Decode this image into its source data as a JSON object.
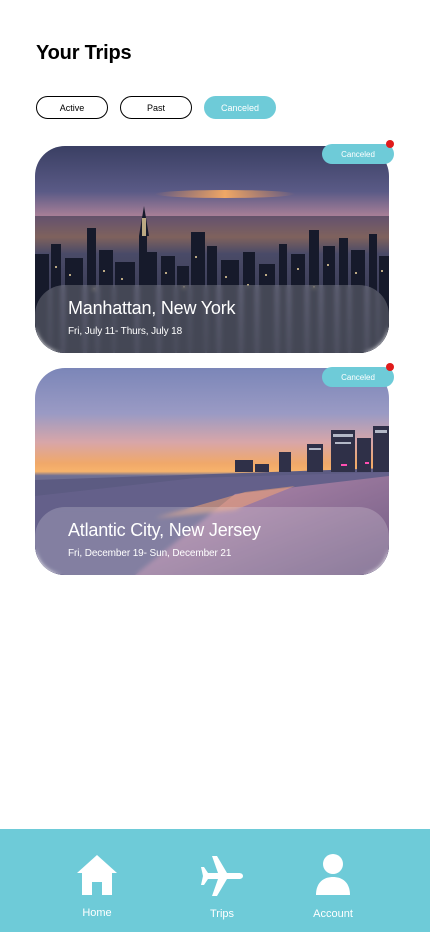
{
  "header": {
    "title": "Your Trips"
  },
  "filters": [
    {
      "label": "Active",
      "selected": false
    },
    {
      "label": "Past",
      "selected": false
    },
    {
      "label": "Canceled",
      "selected": true
    }
  ],
  "trips": [
    {
      "title": "Manhattan, New York",
      "dates": "Fri, July 11- Thurs, July 18",
      "status": "Canceled",
      "scene": "city-skyline-dusk"
    },
    {
      "title": "Atlantic City, New Jersey",
      "dates": "Fri, December 19- Sun, December 21",
      "status": "Canceled",
      "scene": "beach-sunset"
    }
  ],
  "tabbar": {
    "items": [
      {
        "label": "Home",
        "icon": "home-icon"
      },
      {
        "label": "Trips",
        "icon": "airplane-icon"
      },
      {
        "label": "Account",
        "icon": "person-icon"
      }
    ]
  },
  "colors": {
    "accent": "#6ecbd8",
    "notification": "#e01b1b",
    "text": "#000000",
    "background": "#ffffff"
  }
}
